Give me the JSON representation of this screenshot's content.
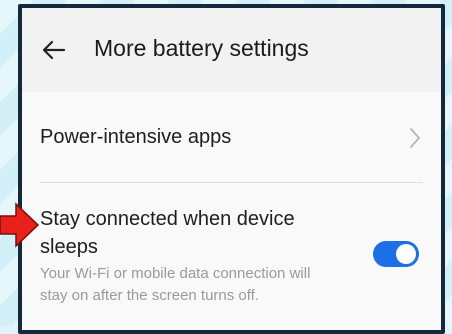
{
  "header": {
    "title": "More battery settings",
    "back_icon": "arrow-left-icon"
  },
  "settings": {
    "power_intensive": {
      "label": "Power-intensive apps",
      "chevron_icon": "chevron-right-icon"
    },
    "stay_connected": {
      "title": "Stay connected when device sleeps",
      "description": "Your Wi-Fi or mobile data connection will stay on after the screen turns off.",
      "enabled": true
    }
  },
  "annotation": {
    "icon": "red-arrow-icon",
    "color": "#e8221b"
  },
  "colors": {
    "toggle_on": "#1d6fe5",
    "frame": "#142a3c"
  }
}
